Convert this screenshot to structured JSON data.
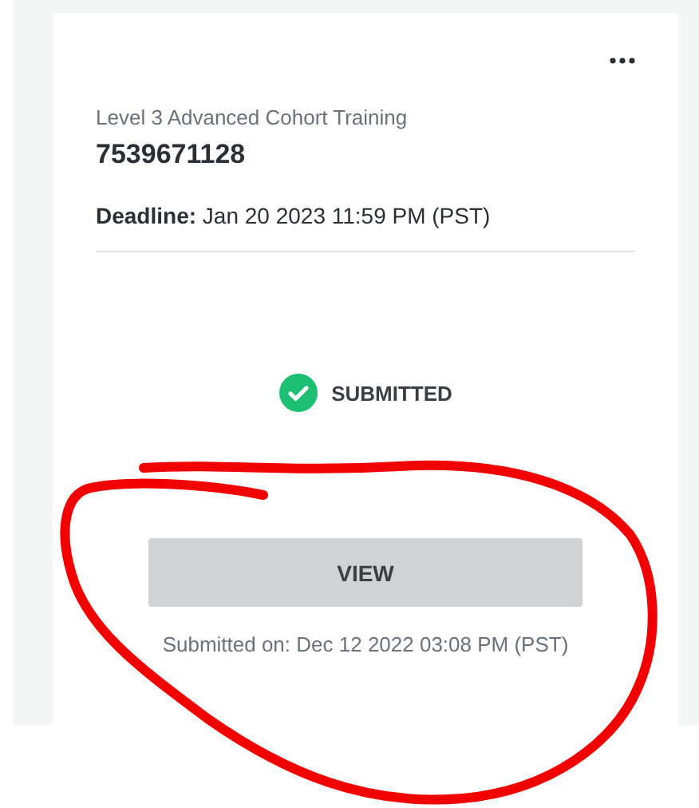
{
  "card": {
    "course": "Level 3 Advanced Cohort Training",
    "id_number": "7539671128",
    "deadline_label": "Deadline:",
    "deadline": "Jan 20 2023 11:59 PM (PST)",
    "status": {
      "kind": "submitted",
      "label": "SUBMITTED"
    },
    "button": "VIEW",
    "submitted_on": "Submitted on: Dec 12 2022 03:08 PM (PST)"
  }
}
